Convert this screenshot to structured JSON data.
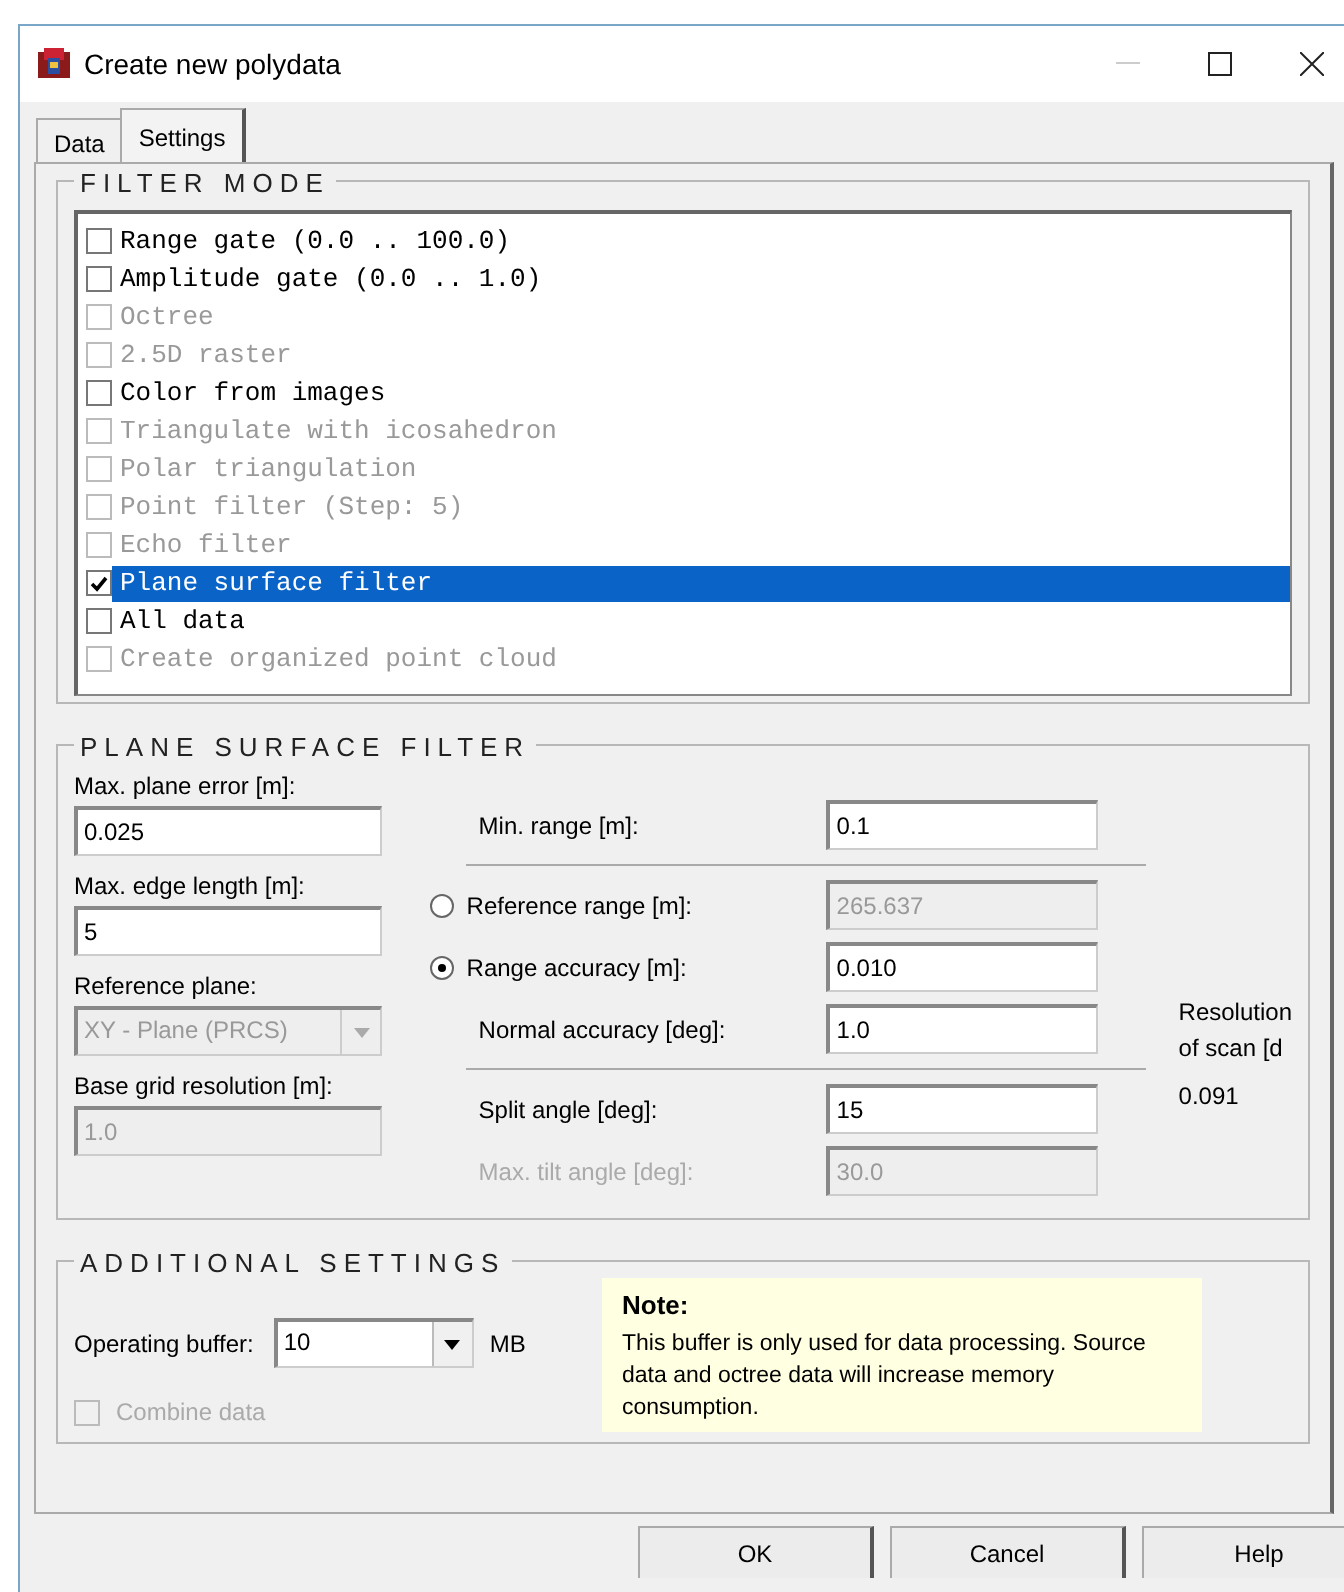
{
  "window": {
    "title": "Create new polydata"
  },
  "tabs": [
    {
      "label": "Data",
      "selected": false
    },
    {
      "label": "Settings",
      "selected": true
    }
  ],
  "filter_mode": {
    "title": "FILTER MODE",
    "items": [
      {
        "label": "Range gate (0.0 .. 100.0)",
        "checked": false,
        "disabled": false,
        "selected": false
      },
      {
        "label": "Amplitude gate (0.0 .. 1.0)",
        "checked": false,
        "disabled": false,
        "selected": false
      },
      {
        "label": "Octree",
        "checked": false,
        "disabled": true,
        "selected": false
      },
      {
        "label": "2.5D raster",
        "checked": false,
        "disabled": true,
        "selected": false
      },
      {
        "label": "Color from images",
        "checked": false,
        "disabled": false,
        "selected": false
      },
      {
        "label": "Triangulate with icosahedron",
        "checked": false,
        "disabled": true,
        "selected": false
      },
      {
        "label": "Polar triangulation",
        "checked": false,
        "disabled": true,
        "selected": false
      },
      {
        "label": "Point filter (Step: 5)",
        "checked": false,
        "disabled": true,
        "selected": false
      },
      {
        "label": "Echo filter",
        "checked": false,
        "disabled": true,
        "selected": false
      },
      {
        "label": "Plane surface filter",
        "checked": true,
        "disabled": false,
        "selected": true
      },
      {
        "label": "All data",
        "checked": false,
        "disabled": false,
        "selected": false
      },
      {
        "label": "Create organized point cloud",
        "checked": false,
        "disabled": true,
        "selected": false
      }
    ]
  },
  "plane_surface_filter": {
    "title": "PLANE SURFACE FILTER",
    "left_fields": [
      {
        "kind": "text",
        "label": "Max. plane error [m]:",
        "value": "0.025",
        "disabled": false
      },
      {
        "kind": "text",
        "label": "Max. edge length [m]:",
        "value": "5",
        "disabled": false
      },
      {
        "kind": "select",
        "label": "Reference plane:",
        "value": "XY - Plane (PRCS)",
        "disabled": true
      },
      {
        "kind": "text",
        "label": "Base grid resolution [m]:",
        "value": "1.0",
        "disabled": true
      }
    ],
    "right_rows": [
      {
        "kind": "field",
        "label": "Min. range [m]:",
        "value": "0.1",
        "disabled": false
      },
      {
        "kind": "separator"
      },
      {
        "kind": "radio",
        "label": "Reference range [m]:",
        "value": "265.637",
        "disabled": true,
        "selected": false
      },
      {
        "kind": "radio",
        "label": "Range accuracy [m]:",
        "value": "0.010",
        "disabled": false,
        "selected": true
      },
      {
        "kind": "field",
        "label": "Normal accuracy [deg]:",
        "value": "1.0",
        "disabled": false
      },
      {
        "kind": "separator"
      },
      {
        "kind": "field",
        "label": "Split angle [deg]:",
        "value": "15",
        "disabled": false
      },
      {
        "kind": "field",
        "label": "Max. tilt angle [deg]:",
        "value": "30.0",
        "disabled": true
      }
    ],
    "resolution": {
      "label_line_1": "Resolution",
      "label_line_2": "of scan [d",
      "value": "0.091"
    }
  },
  "additional_settings": {
    "title": "ADDITIONAL SETTINGS",
    "buffer_label": "Operating buffer:",
    "buffer_value": "10",
    "buffer_unit": "MB",
    "combine": {
      "label": "Combine data",
      "checked": false,
      "disabled": true
    },
    "note": {
      "title": "Note:",
      "text": "This buffer is only used for data processing. Source data and octree data will increase memory consumption."
    }
  },
  "buttons": [
    "OK",
    "Cancel",
    "Help"
  ]
}
